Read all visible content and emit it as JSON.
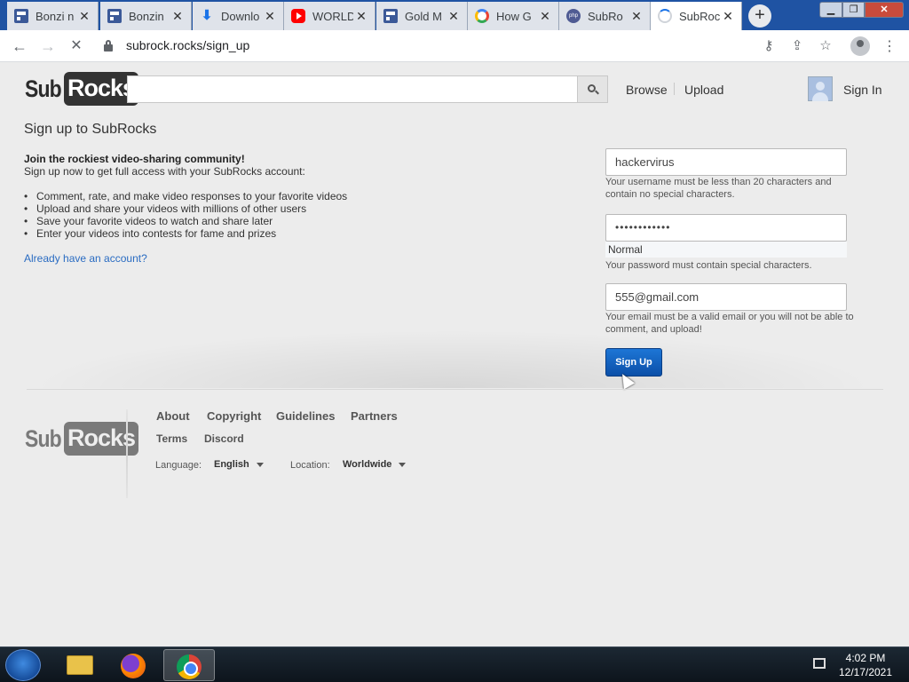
{
  "browser": {
    "tabs": [
      {
        "title": "Bonzi n",
        "icon": "site-icon"
      },
      {
        "title": "Bonzin",
        "icon": "site-icon"
      },
      {
        "title": "Downlo",
        "icon": "download-icon"
      },
      {
        "title": "WORLD",
        "icon": "youtube-icon"
      },
      {
        "title": "Gold M",
        "icon": "site-icon"
      },
      {
        "title": "How G",
        "icon": "google-icon"
      },
      {
        "title": "SubRo",
        "icon": "php-icon"
      },
      {
        "title": "SubRoc",
        "icon": "loading-spinner-icon"
      }
    ],
    "url": "subrock.rocks/sign_up"
  },
  "header": {
    "logo": {
      "sub": "Sub",
      "rocks": "Rocks"
    },
    "search_value": "",
    "nav": {
      "browse": "Browse",
      "upload": "Upload",
      "sign_in": "Sign In"
    }
  },
  "signup": {
    "title": "Sign up to SubRocks",
    "intro_strong": "Join the rockiest video-sharing community!",
    "intro": "Sign up now to get full access with your SubRocks account:",
    "benefits": [
      "Comment, rate, and make video responses to your favorite videos",
      "Upload and share your videos with millions of other users",
      "Save your favorite videos to watch and share later",
      "Enter your videos into contests for fame and prizes"
    ],
    "account_link": "Already have an account?",
    "username": {
      "value": "hackervirus",
      "hint": "Your username must be less than 20 characters and contain no special characters."
    },
    "password": {
      "value": "••••••••••••",
      "strength": "Normal",
      "hint": "Your password must contain special characters."
    },
    "email": {
      "value": "555@gmail.com",
      "hint": "Your email must be a valid email or you will not be able to comment, and upload!"
    },
    "submit": "Sign Up"
  },
  "footer": {
    "links": [
      "About",
      "Copyright",
      "Guidelines",
      "Partners"
    ],
    "links2": [
      "Terms",
      "Discord"
    ],
    "language_label": "Language:",
    "language_value": "English",
    "location_label": "Location:",
    "location_value": "Worldwide"
  },
  "taskbar": {
    "time": "4:02 PM",
    "date": "12/17/2021"
  }
}
